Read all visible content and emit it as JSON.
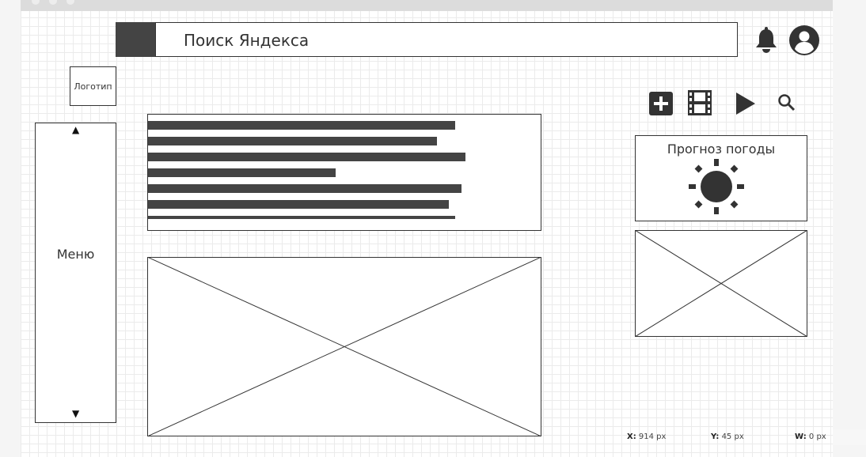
{
  "header": {
    "search_placeholder": "Поиск Яндекса",
    "icons": [
      "bell-icon",
      "user-icon"
    ]
  },
  "logo": {
    "label": "Логотип"
  },
  "menu": {
    "label": "Меню",
    "scroll_up": "▲",
    "scroll_down": "▼"
  },
  "toolbar": {
    "icons": [
      "plus-box-icon",
      "film-icon",
      "play-icon",
      "search-icon"
    ]
  },
  "weather": {
    "title": "Прогноз погоды",
    "icon": "sun-icon"
  },
  "text_lines": 7,
  "status": {
    "x_label": "X:",
    "x_value": "914 px",
    "y_label": "Y:",
    "y_value": "45 px",
    "w_label": "W:",
    "w_value": "0 px"
  },
  "colors": {
    "dark": "#444444",
    "border": "#333333",
    "grid": "#ebebeb"
  }
}
